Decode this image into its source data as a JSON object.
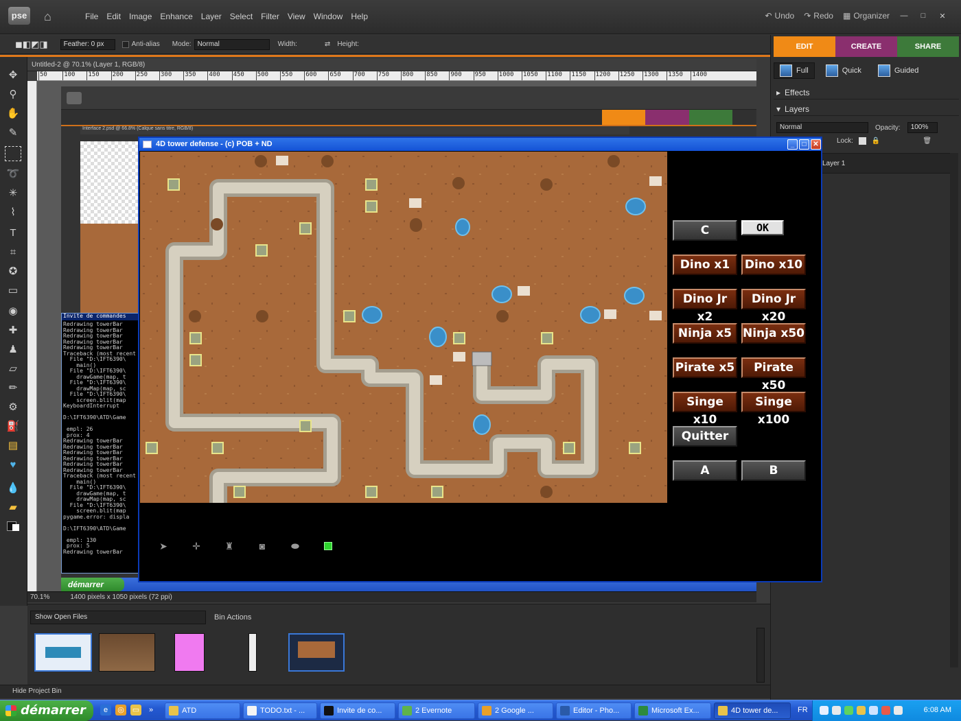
{
  "app": {
    "logo": "pse",
    "menu": [
      "File",
      "Edit",
      "Image",
      "Enhance",
      "Layer",
      "Select",
      "Filter",
      "View",
      "Window",
      "Help"
    ],
    "undo": "Undo",
    "redo": "Redo",
    "organizer": "Organizer"
  },
  "options_bar": {
    "feather": "Feather: 0 px",
    "anti_alias": "Anti-alias",
    "mode_label": "Mode:",
    "mode_value": "Normal",
    "width_label": "Width:",
    "height_label": "Height:"
  },
  "right_panel": {
    "tabs": [
      "EDIT",
      "CREATE",
      "SHARE"
    ],
    "tab_colors": [
      "#f08a16",
      "#8a2f6e",
      "#3d7a3a"
    ],
    "views": [
      "Full",
      "Quick",
      "Guided"
    ],
    "effects": "Effects",
    "layers": "Layers",
    "blend_mode": "Normal",
    "opacity_label": "Opacity:",
    "opacity_value": "100%",
    "lock_label": "Lock:",
    "layer_name": "Layer 1"
  },
  "document": {
    "title": "Untitled-2 @ 70.1% (Layer 1, RGB/8)",
    "ruler_ticks": [
      "50",
      "100",
      "150",
      "200",
      "250",
      "300",
      "350",
      "400",
      "450",
      "500",
      "550",
      "600",
      "650",
      "700",
      "750",
      "800",
      "850",
      "900",
      "950",
      "1000",
      "1050",
      "1100",
      "1150",
      "1200",
      "1250",
      "1300",
      "1350",
      "1400"
    ],
    "zoom": "70.1%",
    "info": "1400 pixels x 1050 pixels (72 ppi)"
  },
  "nested": {
    "doc_title": "Interface 2.psd @ 66.8% (Calque sans titre, RGB/8)",
    "cmd_title": "Invite de commandes",
    "cmd_lines": [
      "Redrawing towerBar",
      "Redrawing towerBar",
      "Redrawing towerBar",
      "Redrawing towerBar",
      "Redrawing towerBar",
      "Traceback (most recent",
      "  File \"D:\\IFT6390\\",
      "    main()",
      "  File \"D:\\IFT6390\\",
      "    drawGame(map, t",
      "  File \"D:\\IFT6390\\",
      "    drawMap(map, sc",
      "  File \"D:\\IFT6390\\",
      "    screen.blit(map",
      "KeyboardInterrupt",
      "",
      "D:\\IFT6390\\ATD\\Game",
      "",
      " empl: 26",
      " prox: 4",
      "Redrawing towerBar",
      "Redrawing towerBar",
      "Redrawing towerBar",
      "Redrawing towerBar",
      "Redrawing towerBar",
      "Redrawing towerBar",
      "Traceback (most recent",
      "    main()",
      "  File \"D:\\IFT6390\\",
      "    drawGame(map, t",
      "    drawMap(map, sc",
      "  File \"D:\\IFT6390\\",
      "    screen.blit(map",
      "pygame.error: displa",
      "",
      "D:\\IFT6390\\ATD\\Game",
      "",
      " empl: 130",
      " prox: 5",
      "Redrawing towerBar"
    ],
    "start": "démarrer"
  },
  "game": {
    "title": "4D tower defense - (c) POB + ND",
    "btn_c": "C",
    "btn_ok": "OK",
    "buttons": [
      [
        "Dino x1",
        "Dino x10"
      ],
      [
        "Dino Jr x2",
        "Dino Jr x20"
      ],
      [
        "Ninja x5",
        "Ninja x50"
      ],
      [
        "Pirate x5",
        "Pirate x50"
      ],
      [
        "Singe x10",
        "Singe x100"
      ]
    ],
    "quit": "Quitter",
    "btn_a": "A",
    "btn_b": "B",
    "tower_icons": [
      "arrow-tower-icon",
      "cross-tower-icon",
      "cannon-tower-icon",
      "disc-tower-icon",
      "gun-tower-icon",
      "green-gem-icon"
    ]
  },
  "bin": {
    "show_open": "Show Open Files",
    "actions": "Bin Actions",
    "hide": "Hide Project Bin"
  },
  "taskbar": {
    "start": "démarrer",
    "tasks": [
      "ATD",
      "TODO.txt - ...",
      "Invite de co...",
      "2 Evernote",
      "2 Google ...",
      "Editor - Pho...",
      "Microsoft Ex...",
      "4D tower de..."
    ],
    "lang": "FR",
    "clock": "6:08 AM"
  }
}
